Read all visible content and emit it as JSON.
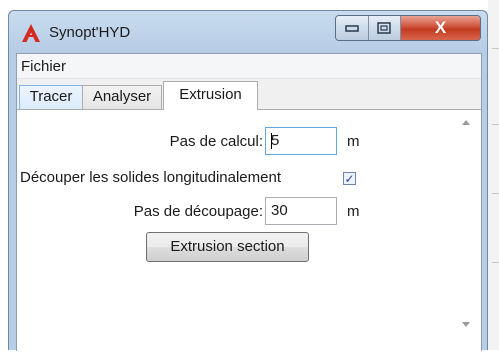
{
  "window": {
    "title": "Synopt'HYD",
    "icon": "app-logo-icon",
    "controls": {
      "minimize": "minimize-icon",
      "maximize": "maximize-icon",
      "close": "close-icon",
      "close_glyph": "X"
    }
  },
  "menu": {
    "items": [
      {
        "label": "Fichier"
      }
    ]
  },
  "tabs": [
    {
      "label": "Tracer",
      "state": "hover"
    },
    {
      "label": "Analyser",
      "state": "normal"
    },
    {
      "label": "Extrusion",
      "state": "selected"
    }
  ],
  "extrusion": {
    "pas_calcul": {
      "label": "Pas de calcul:",
      "value": "5",
      "unit": "m"
    },
    "decouper": {
      "label": "Découper les solides longitudinalement",
      "checked": true,
      "check_glyph": "✓"
    },
    "pas_decoupage": {
      "label": "Pas de découpage:",
      "value": "30",
      "unit": "m"
    },
    "action_button": "Extrusion section"
  },
  "colors": {
    "accent": "#c23b22",
    "focus": "#5ea8e6",
    "chrome": "#b7cde6"
  }
}
